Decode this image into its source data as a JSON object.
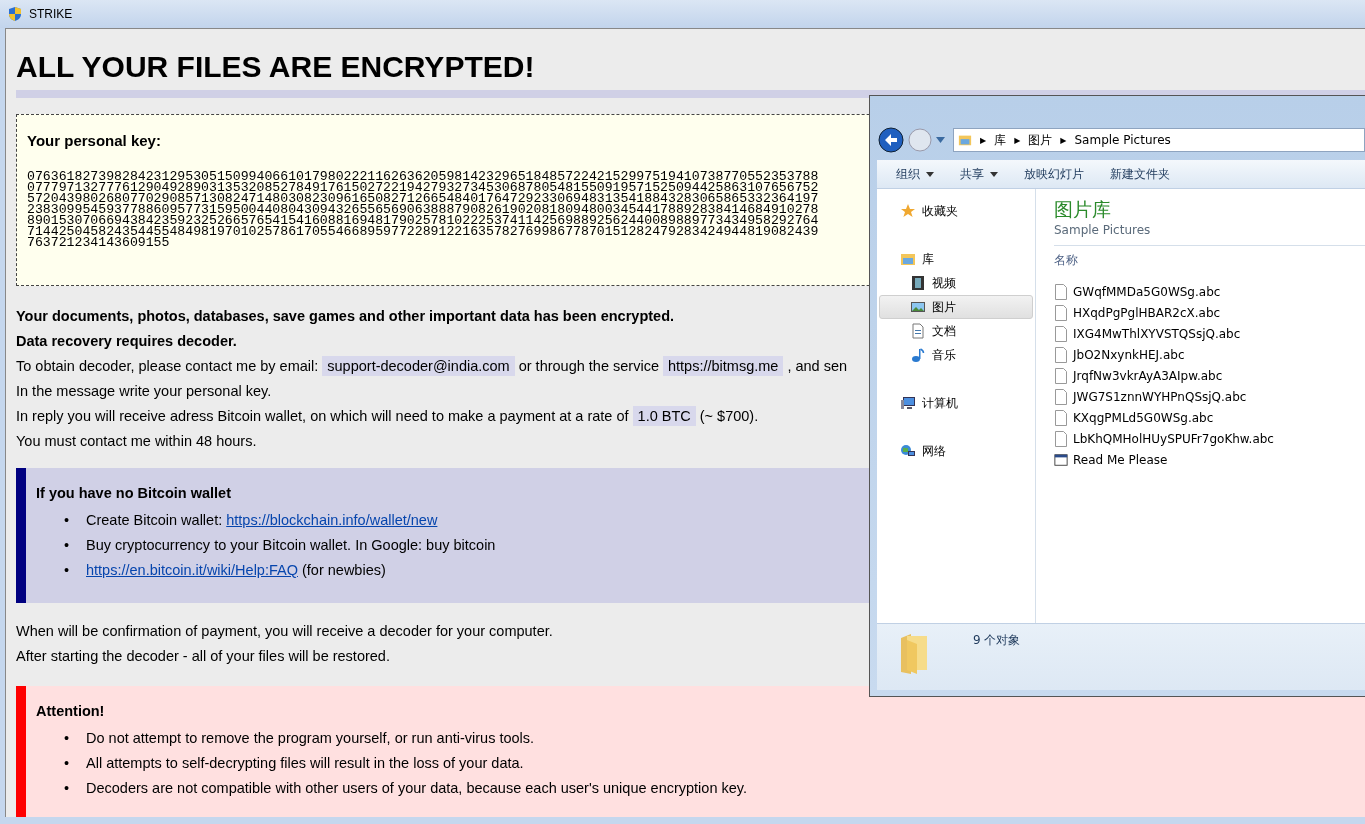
{
  "window": {
    "title": "STRIKE"
  },
  "heading": "ALL YOUR FILES ARE ENCRYPTED!",
  "key_box": {
    "label": "Your personal key:",
    "lines": [
      "0763618273982842312953051509940661017980222116263620598142329651848572242152997519410738770552353788",
      "0777971327776129049289031353208527849176150272219427932734530687805481550919571525094425863107656752",
      "5720439802680770290857130824714803082309616508271266548401764729233069483135418843283065865332364197",
      "2383099545937788609577315950044080430943265565690638887908261902081809480034544178892838414684910278",
      "8901530706694384235923252665765415416088169481790257810222537411425698892562440089889773434958292764",
      "7144250458243544554849819701025786170554668959772289122163578276998677870151282479283424944819082439",
      "763721234143609155"
    ]
  },
  "message": [
    {
      "kind": "bold",
      "segments": [
        {
          "kind": "plain",
          "text": "Your documents, photos, databases, save games and other important data has been encrypted."
        }
      ]
    },
    {
      "kind": "bold",
      "segments": [
        {
          "kind": "plain",
          "text": "Data recovery requires decoder."
        }
      ]
    },
    {
      "kind": "plain",
      "segments": [
        {
          "kind": "plain",
          "text": "To obtain decoder, please contact me by email: "
        },
        {
          "kind": "tag",
          "text": "support-decoder@india.com"
        },
        {
          "kind": "plain",
          "text": " or through the service "
        },
        {
          "kind": "tag",
          "text": "https://bitmsg.me"
        },
        {
          "kind": "plain",
          "text": " , and sen"
        }
      ]
    },
    {
      "kind": "plain",
      "segments": [
        {
          "kind": "plain",
          "text": "In the message write your personal key."
        }
      ]
    },
    {
      "kind": "plain",
      "segments": [
        {
          "kind": "plain",
          "text": "In reply you will receive adress Bitcoin wallet, on which will need to make a payment at a rate of "
        },
        {
          "kind": "tag",
          "text": "1.0 BTC"
        },
        {
          "kind": "plain",
          "text": " (~ $700)."
        }
      ]
    },
    {
      "kind": "plain",
      "segments": [
        {
          "kind": "plain",
          "text": "You must contact me within 48 hours."
        }
      ]
    }
  ],
  "wallet_box": {
    "title": "If you have no Bitcoin wallet",
    "items": [
      {
        "bullet": "•",
        "segments": [
          {
            "kind": "plain",
            "text": "Create Bitcoin wallet: "
          },
          {
            "kind": "link",
            "text": "https://blockchain.info/wallet/new"
          }
        ]
      },
      {
        "bullet": "•",
        "segments": [
          {
            "kind": "plain",
            "text": "Buy cryptocurrency to your Bitcoin wallet. In Google: buy bitcoin"
          }
        ]
      },
      {
        "bullet": "•",
        "segments": [
          {
            "kind": "link",
            "text": "https://en.bitcoin.it/wiki/Help:FAQ"
          },
          {
            "kind": "plain",
            "text": " (for newbies)"
          }
        ]
      }
    ]
  },
  "after": [
    "When will be confirmation of payment, you will receive a decoder for your computer.",
    "After starting the decoder - all of your files will be restored."
  ],
  "attention_box": {
    "title": "Attention!",
    "items": [
      {
        "bullet": "•",
        "segments": [
          {
            "kind": "plain",
            "text": "Do not attempt to remove the program yourself, or run anti-virus tools."
          }
        ]
      },
      {
        "bullet": "•",
        "segments": [
          {
            "kind": "plain",
            "text": "All attempts to self-decrypting files will result in the loss of your data."
          }
        ]
      },
      {
        "bullet": "•",
        "segments": [
          {
            "kind": "plain",
            "text": "Decoders are not compatible with other users of your data, because each user's unique encryption key."
          }
        ]
      }
    ]
  },
  "explorer": {
    "address_separator": "▶",
    "address": [
      "库",
      "图片",
      "Sample Pictures"
    ],
    "toolbar": [
      {
        "label": "组织",
        "dropdown": true
      },
      {
        "label": "共享",
        "dropdown": true
      },
      {
        "label": "放映幻灯片",
        "dropdown": false
      },
      {
        "label": "新建文件夹",
        "dropdown": false
      }
    ],
    "nav": [
      {
        "label": "收藏夹",
        "kind": "star",
        "selected": false
      },
      {
        "label": "库",
        "kind": "library",
        "selected": false,
        "children": [
          {
            "label": "视频",
            "kind": "video",
            "selected": false
          },
          {
            "label": "图片",
            "kind": "pictures",
            "selected": true
          },
          {
            "label": "文档",
            "kind": "document",
            "selected": false
          },
          {
            "label": "音乐",
            "kind": "music",
            "selected": false
          }
        ]
      },
      {
        "label": "计算机",
        "kind": "computer",
        "selected": false
      },
      {
        "label": "网络",
        "kind": "network",
        "selected": false
      }
    ],
    "library_title": "图片库",
    "library_subtitle": "Sample Pictures",
    "column": "名称",
    "files": [
      {
        "name": "GWqfMMDa5G0WSg.abc",
        "kind": "file"
      },
      {
        "name": "HXqdPgPglHBAR2cX.abc",
        "kind": "file"
      },
      {
        "name": "IXG4MwThlXYVSTQSsjQ.abc",
        "kind": "file"
      },
      {
        "name": "JbO2NxynkHEJ.abc",
        "kind": "file"
      },
      {
        "name": "JrqfNw3vkrAyA3AIpw.abc",
        "kind": "file"
      },
      {
        "name": "JWG7S1znnWYHPnQSsjQ.abc",
        "kind": "file"
      },
      {
        "name": "KXqgPMLd5G0WSg.abc",
        "kind": "file"
      },
      {
        "name": "LbKhQMHolHUySPUFr7goKhw.abc",
        "kind": "file"
      },
      {
        "name": "Read Me Please",
        "kind": "app"
      }
    ],
    "status": "9 个对象"
  }
}
